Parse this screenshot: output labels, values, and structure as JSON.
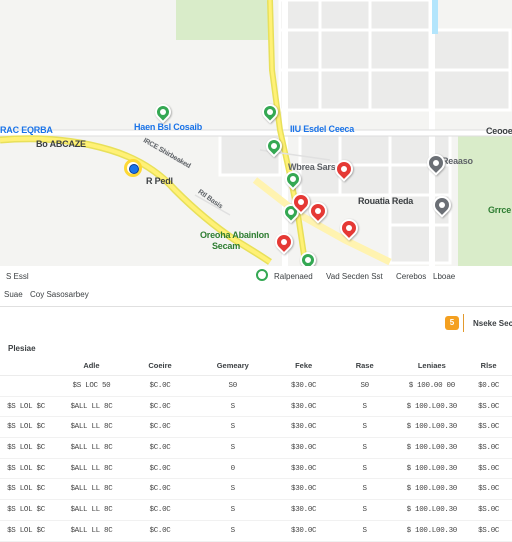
{
  "map": {
    "labels": {
      "top_left_short": "",
      "left_street": "RAC EQRBA",
      "left_street2": "Bo ABCAZE",
      "route_label": "IRCE Shirbeaked",
      "center_top": "Haen Bsl Cosaib",
      "marker_label": "R Pedl",
      "right_top": "IIU Esdel Ceeca",
      "right_edge": "Ceooe",
      "center_mid": "Wbrea Sarsoa",
      "poi_right": "Reaaso",
      "poi_right2": "Rouatia Reda",
      "park_right": "Grrce",
      "road_label": "Rtl Basis",
      "green_area": "Oreoha Abainlon",
      "green_area2": "Secam"
    },
    "colors": {
      "route": "#fff176",
      "route_edge": "#e8e05a",
      "park": "#d9ecc9",
      "road": "#ffffff",
      "block": "#ebebea",
      "pin_red": "#e53935",
      "pin_gray": "#6b6f75",
      "pin_green": "#34a853",
      "accent_blue": "#1a73e8"
    }
  },
  "strip": {
    "left_top": "S Essl",
    "left_bottom1": "Suae",
    "left_bottom2": "Coy Sasosarbey",
    "chip1": "Ralpenaed",
    "chip2": "Vad Secden Sst",
    "chip3": "Cerebos",
    "chip4": "Lboae"
  },
  "panel": {
    "badge_icon": "5",
    "badge_text": "Nseke Sec",
    "section_title": "Plesiae",
    "columns": [
      "",
      "Adle",
      "Coeire",
      "Gemeary",
      "Feke",
      "Rase",
      "Leniaes",
      "Rlse"
    ],
    "rows": [
      [
        "",
        "$S LOC 50",
        "$C.0C",
        "S0",
        "$30.0C",
        "S0",
        "$ 100.00 00",
        "$0.0C"
      ],
      [
        "$S LOL $C",
        "$ALL LL 8C",
        "$C.0C",
        "S",
        "$30.0C",
        "S",
        "$ 100.L00.30",
        "$S.0C"
      ],
      [
        "$S LOL $C",
        "$ALL LL 8C",
        "$C.0C",
        "S",
        "$30.0C",
        "S",
        "$ 100.L00.30",
        "$S.0C"
      ],
      [
        "$S LOL $C",
        "$ALL LL 8C",
        "$C.0C",
        "S",
        "$30.0C",
        "S",
        "$ 100.L00.30",
        "$S.0C"
      ],
      [
        "$S LOL $C",
        "$ALL LL 8C",
        "$C.0C",
        "0",
        "$30.0C",
        "S",
        "$ 100.L00.30",
        "$S.0C"
      ],
      [
        "$S LOL $C",
        "$ALL LL 8C",
        "$C.0C",
        "S",
        "$30.0C",
        "S",
        "$ 100.L00.30",
        "$S.0C"
      ],
      [
        "$S LOL $C",
        "$ALL LL 8C",
        "$C.0C",
        "S",
        "$30.0C",
        "S",
        "$ 100.L00.30",
        "$S.0C"
      ],
      [
        "$S LOL $C",
        "$ALL LL 8C",
        "$C.0C",
        "S",
        "$30.0C",
        "S",
        "$ 100.L00.30",
        "$S.0C"
      ]
    ]
  }
}
